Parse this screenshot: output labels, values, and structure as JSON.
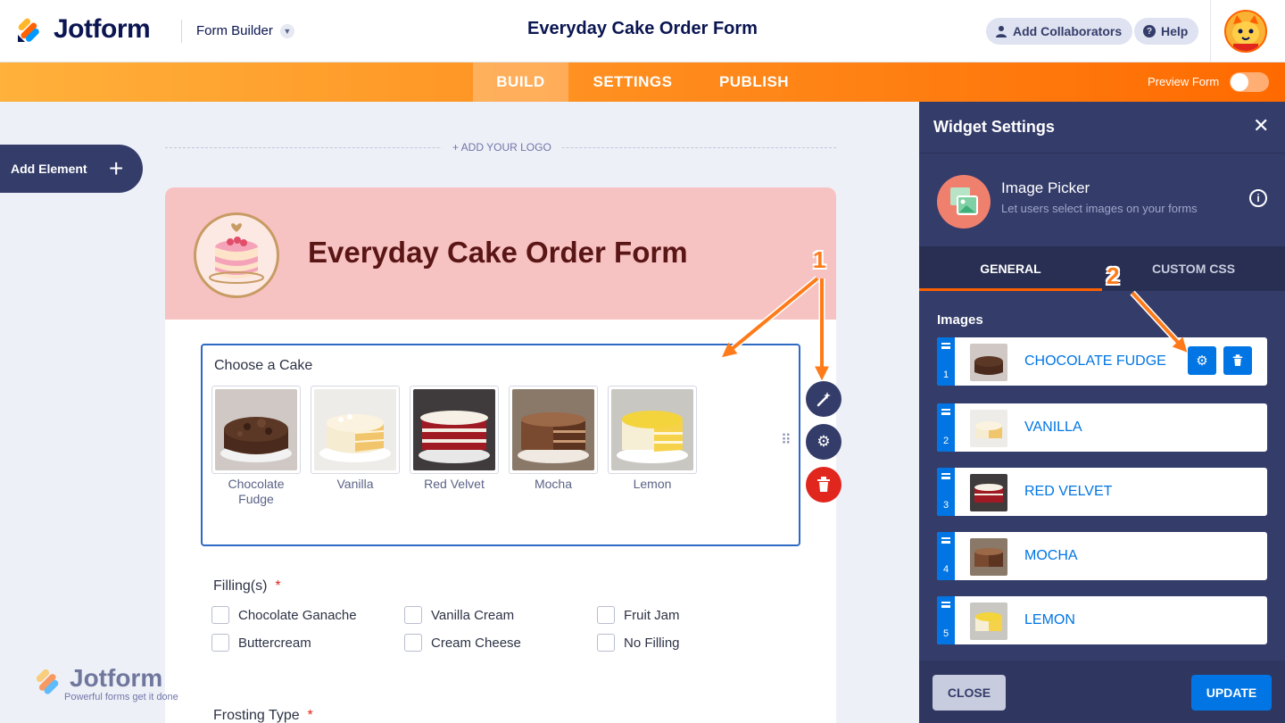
{
  "app": {
    "brand": "Jotform",
    "builder_label": "Form Builder",
    "form_title": "Everyday Cake Order Form",
    "add_collaborators": "Add Collaborators",
    "help": "Help"
  },
  "nav": {
    "tabs": [
      "BUILD",
      "SETTINGS",
      "PUBLISH"
    ],
    "active": "BUILD",
    "preview_label": "Preview Form",
    "preview_on": false
  },
  "canvas": {
    "add_element": "Add Element",
    "add_logo": "+ ADD YOUR LOGO",
    "form_heading": "Everyday Cake Order Form",
    "cake_question": "Choose a Cake",
    "cakes": [
      "Chocolate Fudge",
      "Vanilla",
      "Red Velvet",
      "Mocha",
      "Lemon"
    ],
    "filling_question": "Filling(s)",
    "filling_required": "*",
    "fillings": [
      "Chocolate Ganache",
      "Vanilla Cream",
      "Fruit Jam",
      "Buttercream",
      "Cream Cheese",
      "No Filling"
    ],
    "frosting_question": "Frosting Type",
    "frosting_required": "*"
  },
  "watermark": {
    "brand": "Jotform",
    "tagline": "Powerful forms get it done"
  },
  "panel": {
    "title": "Widget Settings",
    "widget_name": "Image Picker",
    "widget_desc": "Let users select images on your forms",
    "tabs": [
      "GENERAL",
      "CUSTOM CSS"
    ],
    "active_tab": "GENERAL",
    "images_label": "Images",
    "images": [
      {
        "index": "1",
        "name": "CHOCOLATE FUDGE"
      },
      {
        "index": "2",
        "name": "VANILLA"
      },
      {
        "index": "3",
        "name": "RED VELVET"
      },
      {
        "index": "4",
        "name": "MOCHA"
      },
      {
        "index": "5",
        "name": "LEMON"
      }
    ],
    "close_label": "CLOSE",
    "update_label": "UPDATE"
  },
  "annotations": [
    "1",
    "2"
  ],
  "colors": {
    "accent_orange": "#ff6100",
    "panel_bg": "#343c6a",
    "link_blue": "#0075e3",
    "header_pink": "#f7c2c2",
    "delete_red": "#e0261d"
  }
}
